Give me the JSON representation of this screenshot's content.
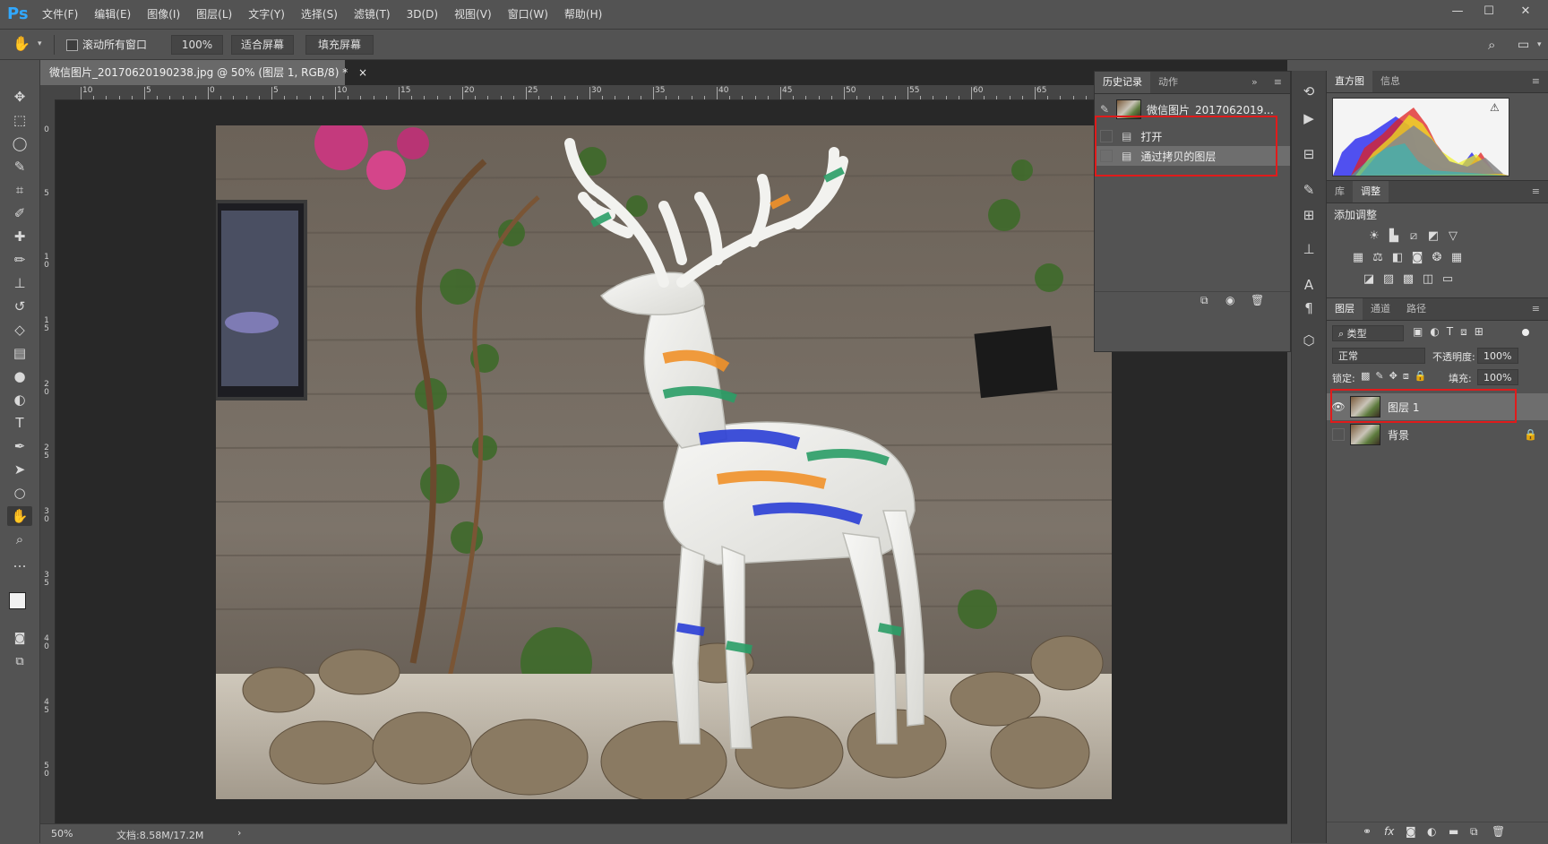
{
  "app": {
    "logo": "Ps"
  },
  "menu": [
    "文件(F)",
    "编辑(E)",
    "图像(I)",
    "图层(L)",
    "文字(Y)",
    "选择(S)",
    "滤镜(T)",
    "3D(D)",
    "视图(V)",
    "窗口(W)",
    "帮助(H)"
  ],
  "window_controls": {
    "minimize": "—",
    "maximize": "☐",
    "close": "✕"
  },
  "options": {
    "tool_icon": "hand-icon",
    "scroll_all_label": "滚动所有窗口",
    "zoom_value": "100%",
    "fit_screen": "适合屏幕",
    "fill_screen": "填充屏幕"
  },
  "document": {
    "tab_title": "微信图片_20170620190238.jpg @ 50% (图层 1, RGB/8) *",
    "close": "×",
    "ruler_h": [
      "10",
      "5",
      "0",
      "5",
      "10",
      "15",
      "20",
      "25",
      "30",
      "35",
      "40",
      "45",
      "50",
      "55",
      "60",
      "65"
    ],
    "ruler_v": [
      "0",
      "5",
      "1 0",
      "1 5",
      "2 0",
      "2 5",
      "3 0",
      "3 5",
      "4 0",
      "4 5",
      "5 0"
    ]
  },
  "status": {
    "zoom": "50%",
    "doc_size": "文档:8.58M/17.2M",
    "arrow": "›"
  },
  "history_panel": {
    "tabs": [
      "历史记录",
      "动作"
    ],
    "expand": "»",
    "menu": "≡",
    "snapshot": "微信图片_2017062019...",
    "items": [
      "打开",
      "通过拷贝的图层"
    ]
  },
  "histogram_panel": {
    "tabs": [
      "直方图",
      "信息"
    ],
    "warning": "⚠"
  },
  "adjust_panel": {
    "tabs": [
      "库",
      "调整"
    ],
    "title": "添加调整"
  },
  "layers_panel": {
    "tabs": [
      "图层",
      "通道",
      "路径"
    ],
    "filter": "类型",
    "blend_mode": "正常",
    "opacity_label": "不透明度:",
    "opacity_value": "100%",
    "lock_label": "锁定:",
    "fill_label": "填充:",
    "fill_value": "100%",
    "layers": [
      {
        "name": "图层 1",
        "selected": true,
        "visible": true
      },
      {
        "name": "背景",
        "selected": false,
        "visible": false
      }
    ],
    "footer_icons": [
      "link-icon",
      "fx-icon",
      "mask-icon",
      "adjustment-icon",
      "group-icon",
      "new-layer-icon",
      "trash-icon"
    ]
  },
  "colors": {
    "accent_blue": "#31a8ff",
    "highlight_red": "#e01b1b",
    "panel_bg": "#535353"
  }
}
